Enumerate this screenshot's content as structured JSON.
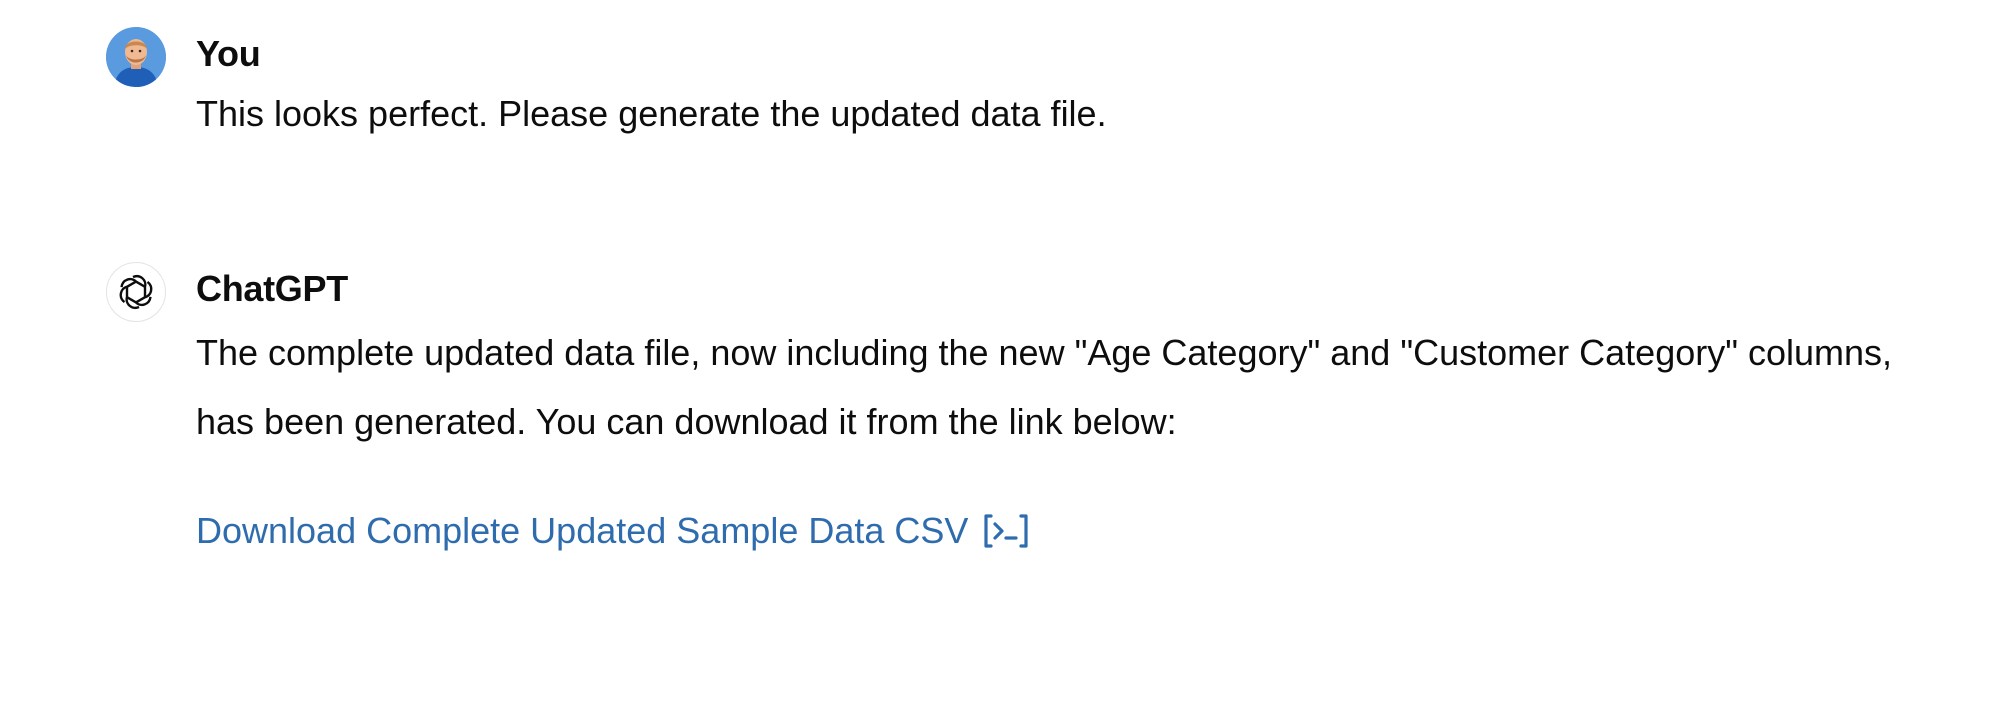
{
  "conversation": {
    "user_message": {
      "author": "You",
      "text": "This looks perfect. Please generate the updated data file."
    },
    "assistant_message": {
      "author": "ChatGPT",
      "text": "The complete updated data file, now including the new \"Age Category\" and \"Customer Category\" columns, has been generated. You can download it from the link below:",
      "link_label": "Download Complete Updated Sample Data CSV",
      "link_icon": "code-interpreter-icon"
    }
  },
  "colors": {
    "link": "#2f6cad",
    "text": "#0d0d0d",
    "user_avatar_bg": "#4a8fd9"
  }
}
